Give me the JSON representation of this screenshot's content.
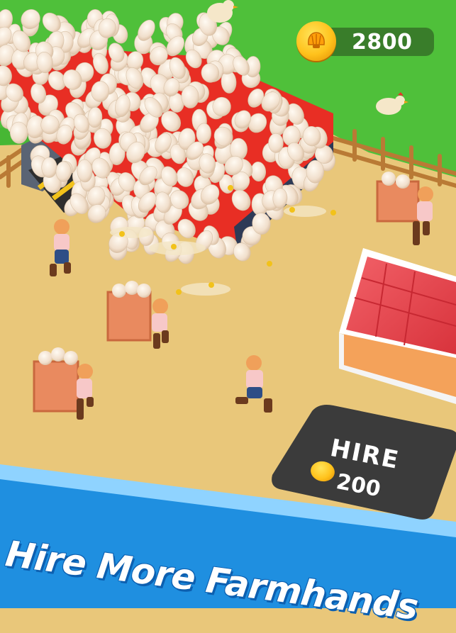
{
  "hud": {
    "coins": "2800",
    "coin_icon": "shell-coin-icon"
  },
  "hire_pad": {
    "label": "HIRE",
    "cost": "200"
  },
  "banner": {
    "headline": "Hire More Farmhands"
  },
  "colors": {
    "grass": "#4fc03a",
    "sand": "#e9c77a",
    "banner_blue": "#1f8fe0",
    "barn_roof": "#e8464e",
    "pad_dark": "#3b3b3b",
    "coin_gold": "#ffc21c"
  }
}
